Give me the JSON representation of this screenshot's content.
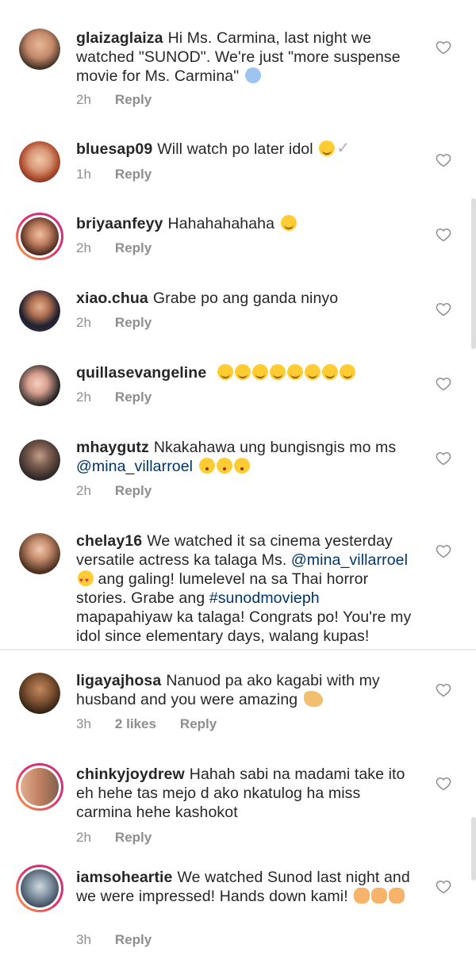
{
  "comments": [
    {
      "user": "glaizaglaiza",
      "text": "Hi Ms. Carmina, last night we watched \"SUNOD\". We're just \"more suspense movie for Ms. Carmina\"",
      "time": "2h",
      "reply": "Reply",
      "likes": "",
      "emoji": "scream"
    },
    {
      "user": "bluesap09",
      "text": "Will watch po later idol",
      "time": "1h",
      "reply": "Reply",
      "likes": "",
      "emoji": "smile-check"
    },
    {
      "user": "briyaanfeyy",
      "text": "Hahahahahaha",
      "time": "2h",
      "reply": "Reply",
      "likes": "",
      "emoji": "laugh"
    },
    {
      "user": "xiao.chua",
      "text": "Grabe po ang ganda ninyo",
      "time": "2h",
      "reply": "Reply",
      "likes": "",
      "emoji": ""
    },
    {
      "user": "quillasevangeline",
      "text": "",
      "time": "2h",
      "reply": "Reply",
      "likes": "",
      "emoji": "smile-x8"
    },
    {
      "user": "mhaygutz",
      "text": "Nkakahawa ung bungisngis mo ms",
      "mention": "@mina_villarroel",
      "time": "2h",
      "reply": "Reply",
      "likes": "",
      "emoji": "kiss-x3"
    },
    {
      "user": "chelay16",
      "text1": "We watched it sa cinema yesterday versatile actress ka talaga Ms.",
      "mention": "@mina_villarroel",
      "text2": "ang galing! lumelevel na sa Thai horror stories. Grabe ang",
      "hashtag": "#sunodmovieph",
      "text3": "mapapahiyaw ka talaga! Congrats po! You're my idol since elementary days, walang kupas!"
    },
    {
      "user": "ligayajhosa",
      "text": "Nanuod pa ako kagabi with my husband and you were amazing",
      "time": "3h",
      "likes": "2 likes",
      "reply": "Reply",
      "emoji": "muscle"
    },
    {
      "user": "chinkyjoydrew",
      "text": "Hahah sabi na madami take ito eh hehe tas mejo d ako nkatulog ha miss carmina hehe kashokot",
      "time": "2h",
      "reply": "Reply",
      "likes": "",
      "emoji": ""
    },
    {
      "user": "iamsoheartie",
      "text": "We watched Sunod last night and we were impressed! Hands down kami!",
      "time": "3h",
      "reply": "Reply",
      "likes": "",
      "emoji": "pray-x3"
    }
  ],
  "colors": {
    "accent": "#003569",
    "meta": "#8e8e8e",
    "text": "#262626"
  }
}
